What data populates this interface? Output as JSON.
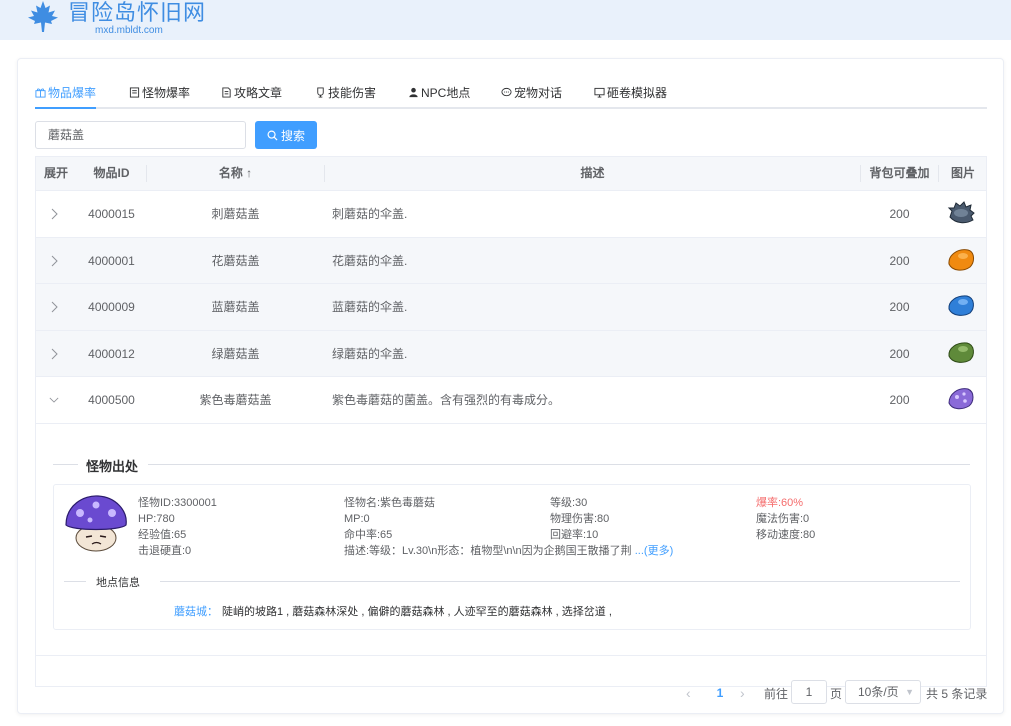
{
  "brand": {
    "title": "冒险岛怀旧网",
    "subtitle": "mxd.mbldt.com"
  },
  "tabs": [
    {
      "label": "物品爆率",
      "icon": "gift-icon"
    },
    {
      "label": "怪物爆率",
      "icon": "document-icon"
    },
    {
      "label": "攻略文章",
      "icon": "article-icon"
    },
    {
      "label": "技能伤害",
      "icon": "cup-icon"
    },
    {
      "label": "NPC地点",
      "icon": "user-icon"
    },
    {
      "label": "宠物对话",
      "icon": "chat-icon"
    },
    {
      "label": "砸卷模拟器",
      "icon": "monitor-icon"
    }
  ],
  "search": {
    "value": "蘑菇盖",
    "button_label": "搜索"
  },
  "table": {
    "headers": {
      "expand": "展开",
      "id": "物品ID",
      "name": "名称 ↑",
      "desc": "描述",
      "stack": "背包可叠加",
      "image": "图片"
    },
    "rows": [
      {
        "id": "4000015",
        "name": "刺蘑菇盖",
        "desc": "刺蘑菇的伞盖.",
        "stack": "200",
        "color": "#4a5a6e"
      },
      {
        "id": "4000001",
        "name": "花蘑菇盖",
        "desc": "花蘑菇的伞盖.",
        "stack": "200",
        "color": "#f08a10"
      },
      {
        "id": "4000009",
        "name": "蓝蘑菇盖",
        "desc": "蓝蘑菇的伞盖.",
        "stack": "200",
        "color": "#2f7fd8"
      },
      {
        "id": "4000012",
        "name": "绿蘑菇盖",
        "desc": "绿蘑菇的伞盖.",
        "stack": "200",
        "color": "#5f8a3a"
      },
      {
        "id": "4000500",
        "name": "紫色毒蘑菇盖",
        "desc": "紫色毒蘑菇的菌盖。含有强烈的有毒成分。",
        "stack": "200",
        "color": "#8a6ad8"
      }
    ]
  },
  "expanded": {
    "section_title": "怪物出处",
    "monster": {
      "id": "怪物ID:3300001",
      "hp": "HP:780",
      "exp": "经验值:65",
      "knockback": "击退硬直:0",
      "name": "怪物名:紫色毒蘑菇",
      "mp": "MP:0",
      "accuracy": "命中率:65",
      "desc": "描述:等级：Lv.30\\n形态：植物型\\n\\n因为企鹅国王散播了荆",
      "more": "...(更多)",
      "level": "等级:30",
      "phys_dmg": "物理伤害:80",
      "avoid": "回避率:10",
      "drop_rate": "爆率:60%",
      "magic_dmg": "魔法伤害:0",
      "speed": "移动速度:80"
    },
    "location_title": "地点信息",
    "location_map": "蘑菇城：",
    "location_places": "陡峭的坡路1 , 蘑菇森林深处 , 偏僻的蘑菇森林 , 人迹罕至的蘑菇森林 , 选择岔道 ,"
  },
  "pagination": {
    "current": "1",
    "goto_label": "前往",
    "goto_value": "1",
    "page_label": "页",
    "page_size": "10条/页",
    "total": "共 5 条记录"
  },
  "colors": {
    "accent": "#409eff",
    "drop_rate": "#f56c6c"
  }
}
